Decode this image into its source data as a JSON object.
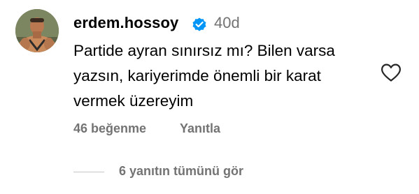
{
  "comment": {
    "avatar_icon": "user-avatar-photo",
    "username": "erdem.hossoy",
    "verified_icon": "verified-badge-icon",
    "verified_color": "#0095f6",
    "time_ago": "40d",
    "text_lines": [
      "Partide ayran sınırsız mı? Bilen varsa",
      "yazsın, kariyerimde önemli bir karat",
      "vermek üzereyim"
    ],
    "like_icon": "heart-outline-icon",
    "likes_label": "46 beğenme",
    "reply_label": "Yanıtla",
    "view_replies_label": "6 yanıtın tümünü gör",
    "secondary_text_color": "#737373"
  }
}
